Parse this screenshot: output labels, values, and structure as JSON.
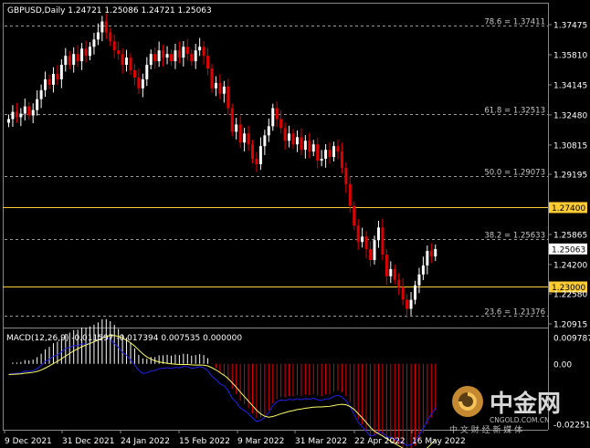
{
  "header": {
    "symbol_info": "GBPUSD,Daily  1.24721 1.25086 1.24721 1.25063"
  },
  "macd": {
    "label": "MACD(12,26,9) -0.011597 -0.017394 0.007535 0.000000"
  },
  "watermark": {
    "brand": "中金网",
    "domain": "CNGOLD.COM.CN",
    "slogan": "中 文 财 经 新 媒 体"
  },
  "colors": {
    "bull": "#ffffff",
    "bear": "#e00000",
    "level": "#ffcc33",
    "macd_main": "#2222ee",
    "macd_signal": "#ffff66"
  },
  "price_axis": [
    {
      "value": 1.37475,
      "text": "1.37475"
    },
    {
      "value": 1.3581,
      "text": "1.35810"
    },
    {
      "value": 1.34145,
      "text": "1.34145"
    },
    {
      "value": 1.3248,
      "text": "1.32480"
    },
    {
      "value": 1.30815,
      "text": "1.30815"
    },
    {
      "value": 1.29195,
      "text": "1.29195"
    },
    {
      "value": 1.25865,
      "text": "1.25865"
    },
    {
      "value": 1.242,
      "text": "1.24200"
    },
    {
      "value": 1.2258,
      "text": "1.22580"
    },
    {
      "value": 1.20915,
      "text": "1.20915"
    }
  ],
  "fib_levels": [
    {
      "value": 1.37411,
      "text": "78.6 = 1.37411"
    },
    {
      "value": 1.32513,
      "text": "61.8 = 1.32513"
    },
    {
      "value": 1.29073,
      "text": "50.0 = 1.29073"
    },
    {
      "value": 1.25633,
      "text": "38.2 = 1.25633"
    },
    {
      "value": 1.21376,
      "text": "23.6 = 1.21376"
    }
  ],
  "key_levels": [
    {
      "value": 1.274,
      "text": "1.27400"
    },
    {
      "value": 1.23,
      "text": "1.23000"
    }
  ],
  "current_price": {
    "value": 1.25063,
    "text": "1.25063"
  },
  "macd_axis": [
    {
      "value": 0.009787,
      "text": "0.009787"
    },
    {
      "value": 0.0,
      "text": "0.00"
    },
    {
      "value": -0.022519,
      "text": "-0.022519"
    }
  ],
  "time_axis": [
    "9 Dec 2021",
    "31 Dec 2021",
    "24 Jan 2022",
    "15 Feb 2022",
    "9 Mar 2022",
    "31 Mar 2022",
    "22 Apr 2022",
    "16 May 2022"
  ],
  "chart_data": {
    "type": "candlestick",
    "closes": [
      1.3225,
      1.3265,
      1.3235,
      1.3255,
      1.3295,
      1.3245,
      1.3275,
      1.3335,
      1.3385,
      1.3445,
      1.3415,
      1.3475,
      1.3445,
      1.3525,
      1.3575,
      1.3525,
      1.3585,
      1.3545,
      1.3615,
      1.3575,
      1.3625,
      1.3665,
      1.3705,
      1.3765,
      1.3705,
      1.3655,
      1.3605,
      1.3585,
      1.3525,
      1.3565,
      1.3495,
      1.3455,
      1.3395,
      1.3445,
      1.3525,
      1.3585,
      1.3545,
      1.3605,
      1.3565,
      1.3585,
      1.3545,
      1.3605,
      1.3565,
      1.3625,
      1.3585,
      1.3545,
      1.3605,
      1.3625,
      1.3575,
      1.3505,
      1.3395,
      1.3425,
      1.3365,
      1.3405,
      1.3285,
      1.3155,
      1.3195,
      1.3095,
      1.3145,
      1.3085,
      1.3005,
      1.2975,
      1.3075,
      1.3135,
      1.3185,
      1.3285,
      1.3225,
      1.3175,
      1.3105,
      1.3145,
      1.3085,
      1.3125,
      1.3055,
      1.3105,
      1.3045,
      1.3085,
      1.2995,
      1.3005,
      1.3055,
      1.3015,
      1.3075,
      1.3045,
      1.2955,
      1.2865,
      1.2745,
      1.2635,
      1.2545,
      1.2575,
      1.2505,
      1.2445,
      1.2555,
      1.2625,
      1.2475,
      1.2355,
      1.2395,
      1.2335,
      1.2295,
      1.2225,
      1.2175,
      1.2225,
      1.2305,
      1.2365,
      1.2415,
      1.2495,
      1.2465,
      1.2506
    ]
  }
}
